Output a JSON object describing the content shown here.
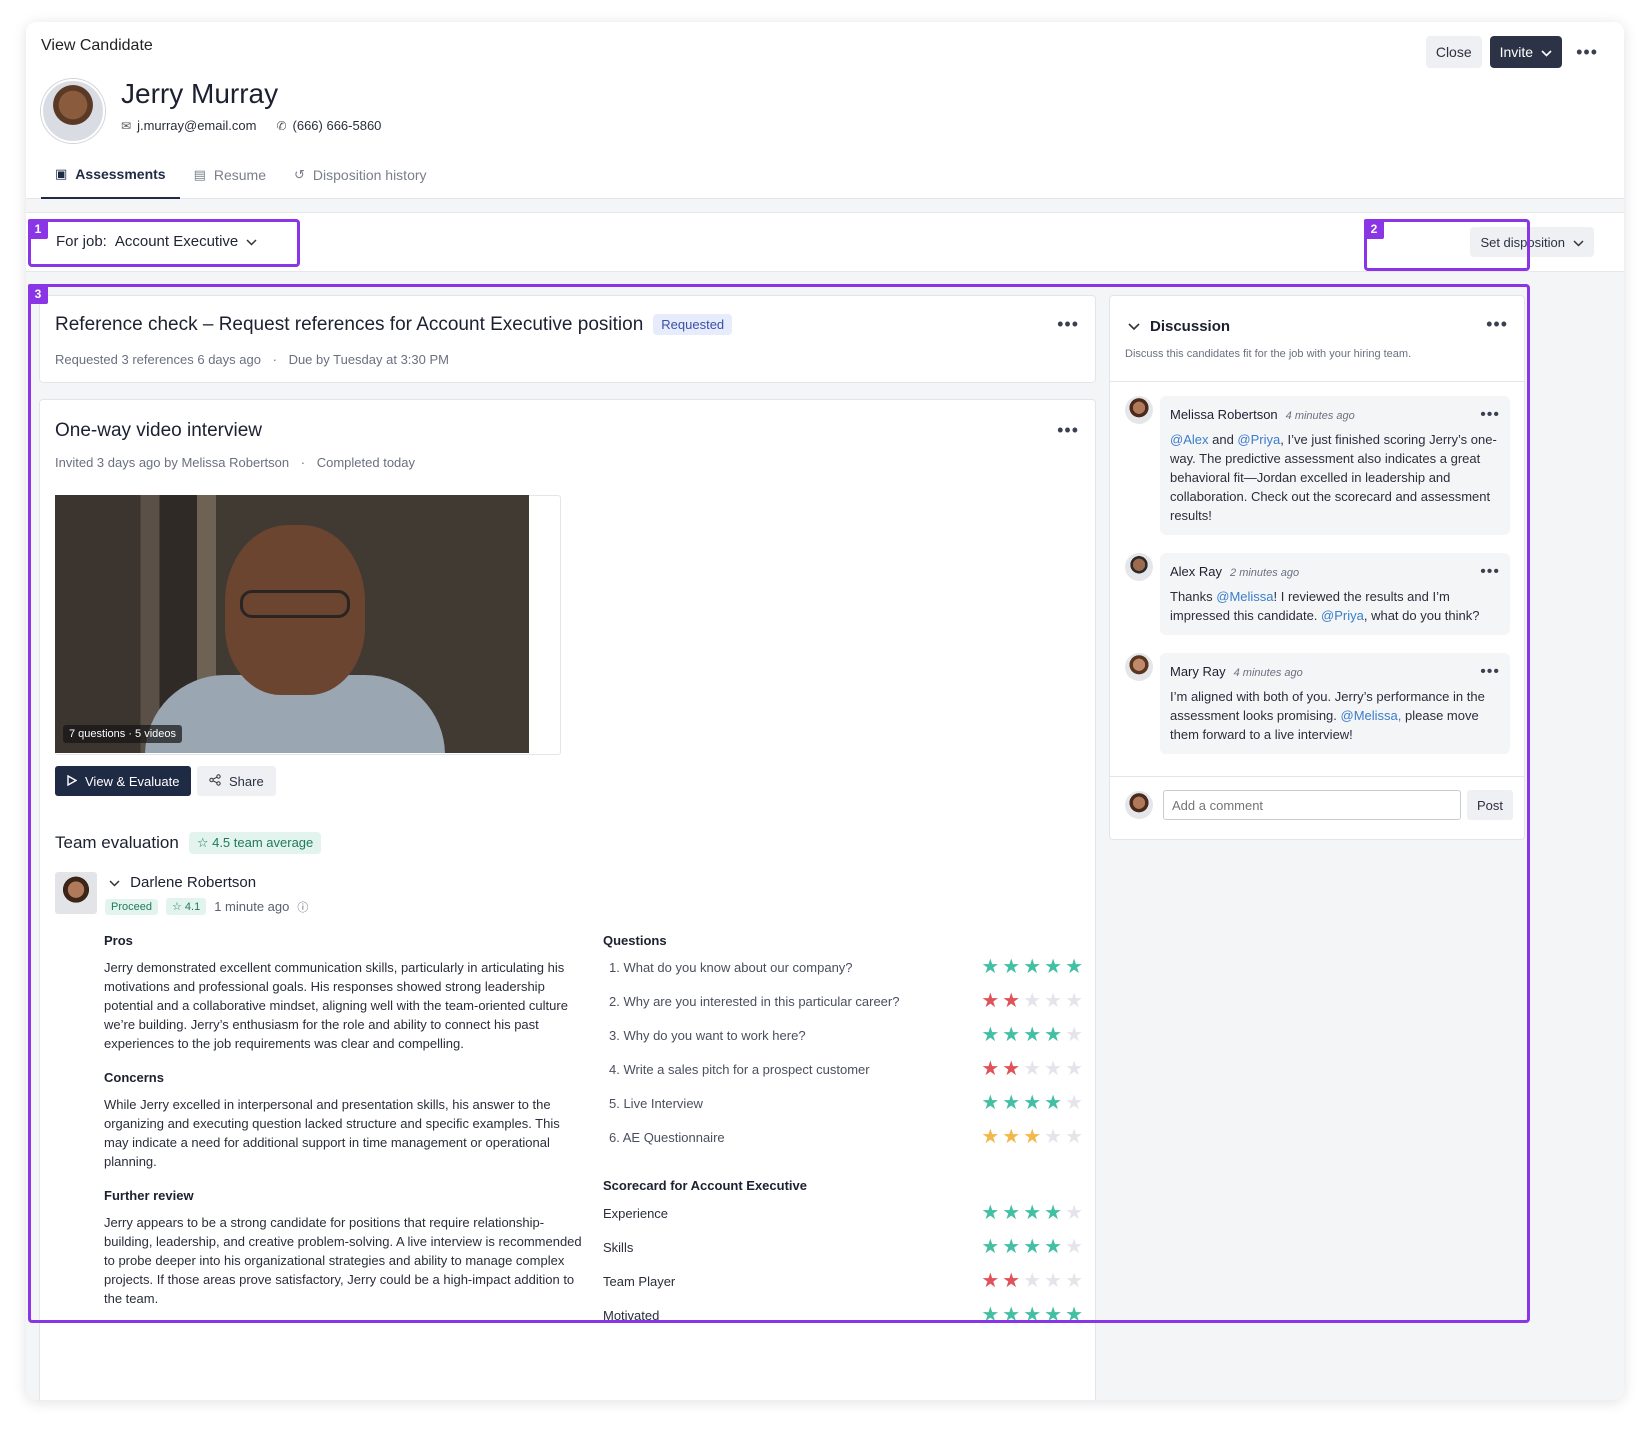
{
  "header": {
    "view_title": "View Candidate",
    "close_label": "Close",
    "invite_label": "Invite",
    "more": "•••"
  },
  "candidate": {
    "name": "Jerry Murray",
    "email": "j.murray@email.com",
    "phone": "(666) 666-5860"
  },
  "tabs": [
    {
      "label": "Assessments",
      "active": true
    },
    {
      "label": "Resume"
    },
    {
      "label": "Disposition history"
    }
  ],
  "jobbar": {
    "for_job_label": "For job:",
    "job_name": "Account Executive",
    "set_disposition": "Set disposition"
  },
  "highlights": {
    "h1": "1",
    "h2": "2",
    "h3": "3"
  },
  "reference": {
    "title": "Reference check – Request references for Account Executive position",
    "status": "Requested",
    "meta1": "Requested 3 references 6 days ago",
    "sep": "·",
    "meta2": "Due by Tuesday at 3:30 PM"
  },
  "video_interview": {
    "title": "One-way video interview",
    "meta1": "Invited 3 days ago by Melissa Robertson",
    "sep": "·",
    "meta2": "Completed today",
    "video_label": "7 questions · 5 videos",
    "view_eval": "View & Evaluate",
    "share": "Share"
  },
  "team": {
    "title": "Team evaluation",
    "average": "4.5 team average",
    "evaluator": {
      "name": "Darlene Robertson",
      "status": "Proceed",
      "score": "4.1",
      "time": "1 minute ago"
    },
    "pros_h": "Pros",
    "pros": "Jerry demonstrated excellent communication skills, particularly in articulating his motivations and professional goals. His responses showed strong leadership potential and a collaborative mindset, aligning well with the team-oriented culture we’re building. Jerry’s enthusiasm for the role and ability to connect his past experiences to the job requirements was clear and compelling.",
    "concerns_h": "Concerns",
    "concerns": "While Jerry excelled in interpersonal and presentation skills, his answer to the organizing and executing question lacked structure and specific examples. This may indicate a need for additional support in time management or operational planning.",
    "further_h": "Further review",
    "further": "Jerry appears to be a strong candidate for positions that require relationship-building, leadership, and creative problem-solving. A live interview is recommended to probe deeper into his organizational strategies and ability to manage complex projects. If those areas prove satisfactory, Jerry could be a high-impact addition to the team.",
    "questions_h": "Questions",
    "questions": [
      {
        "label": "1.  What do you know about our company?",
        "rating": 5,
        "color": "#43bfa3"
      },
      {
        "label": "2.  Why are you interested in this particular career?",
        "rating": 2,
        "color": "#e0525a"
      },
      {
        "label": "3.  Why do you want to work here?",
        "rating": 4,
        "color": "#43bfa3"
      },
      {
        "label": "4.  Write a sales pitch for a prospect customer",
        "rating": 2,
        "color": "#e0525a"
      },
      {
        "label": "5.  Live Interview",
        "rating": 4,
        "color": "#43bfa3"
      },
      {
        "label": "6.  AE Questionnaire",
        "rating": 3,
        "color": "#f2b84b"
      }
    ],
    "scorecard_h": "Scorecard for Account Executive",
    "scorecard": [
      {
        "label": "Experience",
        "rating": 4,
        "color": "#43bfa3"
      },
      {
        "label": "Skills",
        "rating": 4,
        "color": "#43bfa3"
      },
      {
        "label": "Team Player",
        "rating": 2,
        "color": "#e0525a"
      },
      {
        "label": "Motivated",
        "rating": 5,
        "color": "#43bfa3"
      }
    ]
  },
  "discussion": {
    "title": "Discussion",
    "subtitle": "Discuss this candidates fit for the job with your hiring team.",
    "comments": [
      {
        "author": "Melissa Robertson",
        "time": "4 minutes ago"
      },
      {
        "author": "Alex Ray",
        "time": "2 minutes ago"
      },
      {
        "author": "Mary Ray",
        "time": "4 minutes ago"
      }
    ],
    "c1": {
      "m1": "@Alex",
      "t1": " and ",
      "m2": "@Priya",
      "t2": ", I’ve just finished scoring Jerry’s one-way. The predictive assessment also indicates a great behavioral fit—Jordan excelled in leadership and collaboration. Check out the scorecard and assessment results!"
    },
    "c2": {
      "t0": "Thanks ",
      "m1": "@Melissa",
      "t1": "! I reviewed the results and I’m impressed this candidate. ",
      "m2": "@Priya",
      "t2": ", what do you think?"
    },
    "c3": {
      "t0": "I’m aligned with both of you. Jerry’s performance in the assessment looks promising. ",
      "m1": "@Melissa,",
      "t1": " please move them forward to a live interview!"
    },
    "comment_placeholder": "Add a comment",
    "post_label": "Post"
  },
  "colors": {
    "highlight": "#8a35e6",
    "primary": "#1f2a44",
    "star_green": "#43bfa3",
    "star_red": "#e0525a",
    "star_yellow": "#f2b84b"
  }
}
